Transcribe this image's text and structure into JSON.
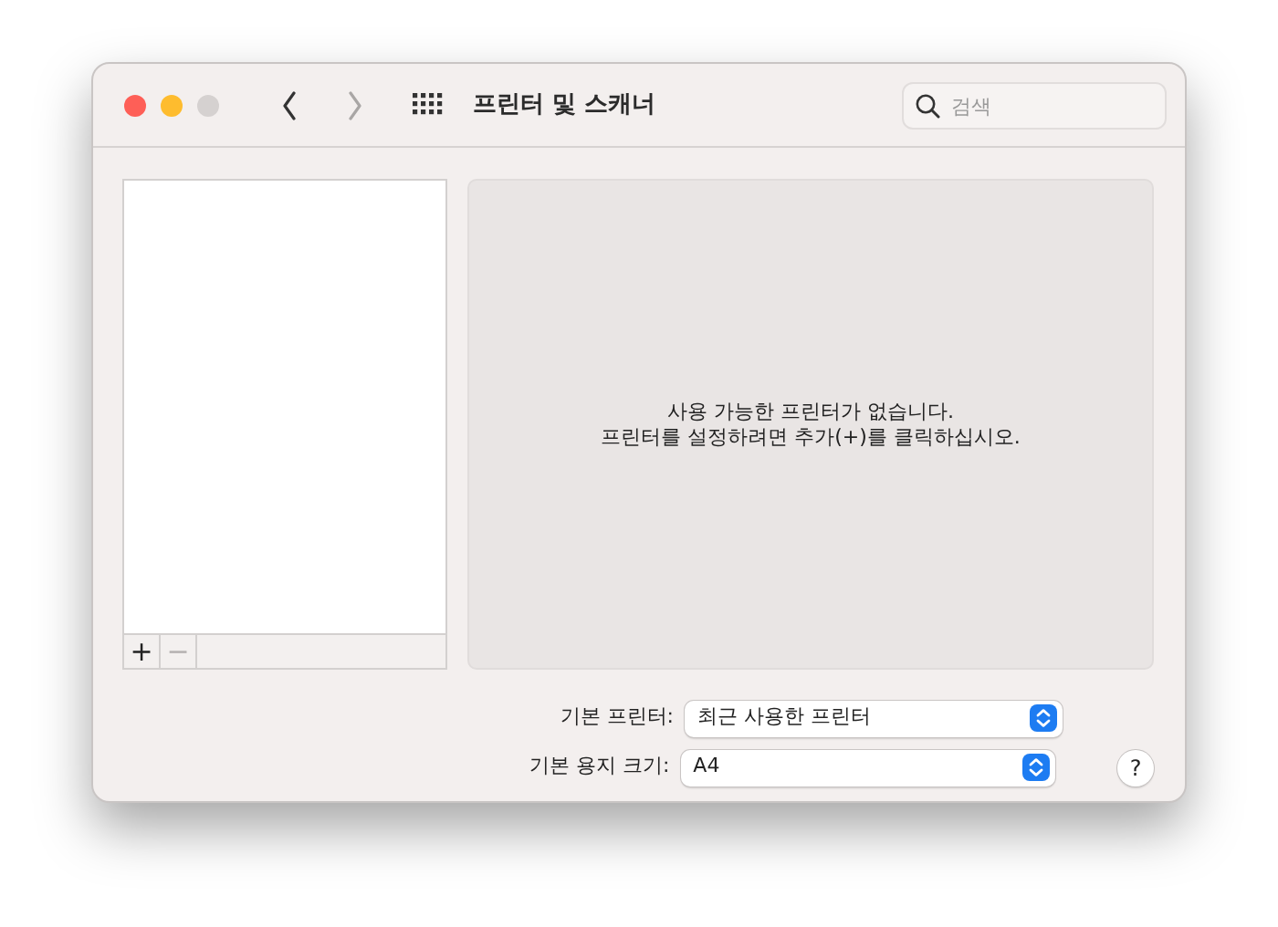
{
  "window": {
    "title": "프린터 및 스캐너"
  },
  "window_controls": [
    {
      "kind": "close",
      "disabled": false
    },
    {
      "kind": "minimize",
      "disabled": false
    },
    {
      "kind": "zoom",
      "disabled": true
    }
  ],
  "navigation": [
    {
      "kind": "back",
      "disabled": false
    },
    {
      "kind": "forward",
      "disabled": true
    }
  ],
  "search": {
    "placeholder": "검색"
  },
  "printer_list": {
    "buttons": [
      {
        "label": "+",
        "disabled": false
      },
      {
        "label": "−",
        "disabled": true
      }
    ]
  },
  "message": [
    "사용 가능한 프린터가 없습니다.",
    "프린터를 설정하려면 추가(+)를 클릭하십시오."
  ],
  "settings": [
    {
      "label": "기본 프린터:",
      "value": "최근 사용한 프린터"
    },
    {
      "label": "기본 용지 크기:",
      "value": "A4"
    }
  ],
  "help_button": "?"
}
